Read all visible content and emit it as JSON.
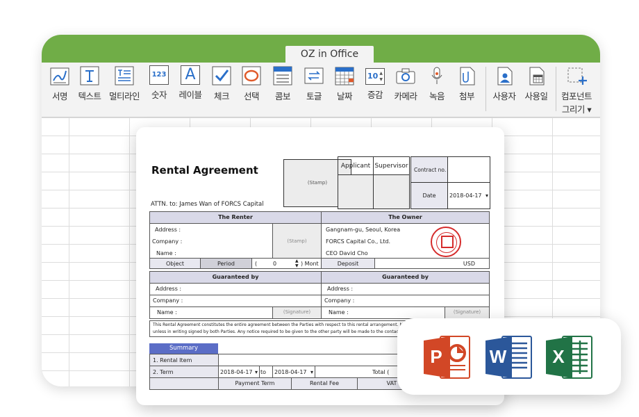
{
  "tab": "OZ in Office",
  "ribbon": [
    {
      "label": "서명",
      "icon": "signature-icon"
    },
    {
      "label": "텍스트",
      "icon": "text-icon"
    },
    {
      "label": "멀티라인",
      "icon": "multiline-icon"
    },
    {
      "label": "숫자",
      "icon": "number-icon"
    },
    {
      "label": "레이블",
      "icon": "label-icon"
    },
    {
      "label": "체크",
      "icon": "check-icon"
    },
    {
      "label": "선택",
      "icon": "select-icon"
    },
    {
      "label": "콤보",
      "icon": "combo-icon"
    },
    {
      "label": "토글",
      "icon": "toggle-icon"
    },
    {
      "label": "날짜",
      "icon": "date-icon"
    },
    {
      "label": "증감",
      "icon": "stepper-icon"
    },
    {
      "label": "카메라",
      "icon": "camera-icon"
    },
    {
      "label": "녹음",
      "icon": "microphone-icon"
    },
    {
      "label": "첨부",
      "icon": "attach-icon"
    },
    {
      "label": "사용자",
      "icon": "user-icon"
    },
    {
      "label": "사용일",
      "icon": "use-date-icon"
    },
    {
      "label": "컴포넌트",
      "label2": "그리기",
      "icon": "draw-component-icon"
    }
  ],
  "ribbon_glyphs": {
    "number": "123",
    "label": "A",
    "stepper": "10"
  },
  "doc": {
    "title": "Rental Agreement",
    "stamp": "(Stamp)",
    "attn": "ATTN. to: James Wan of FORCS Capital",
    "applicant": "Applicant",
    "supervisor": "Supervisor",
    "contract_no": "Contract no.",
    "date_label": "Date",
    "date_value": "2018-04-17",
    "renter": "The Renter",
    "owner": "The Owner",
    "address": "Address :",
    "company": "Company :",
    "name": "Name :",
    "renter_stamp": "(Stamp)",
    "owner_address": "Gangnam-gu, Seoul, Korea",
    "owner_company": "FORCS Capital Co., Ltd.",
    "owner_name": "CEO  David Cho",
    "object": "Object",
    "period": "Period",
    "period_open": "(",
    "period_value": "0",
    "period_unit": ") Mont",
    "deposit": "Deposit",
    "usd": "USD",
    "guaranteed": "Guaranteed by",
    "signature": "(Signature)",
    "legal1": "This Rental Agreement constitutes the entire agreement between the Parties with respect to this rental arrangement.  No m",
    "legal2": "unless in writing signed by both Parties.  Any notice required to be given to the other party will be made to the contact inf",
    "summary": "Summary",
    "rental_item": "1. Rental Item",
    "term": "2. Term",
    "term_from": "2018-04-17",
    "term_to_label": "to",
    "term_to": "2018-04-17",
    "total": "Total (",
    "payment_term": "Payment Term",
    "rental_fee": "Rental Fee",
    "vat": "VAT"
  },
  "apps": [
    {
      "name": "PowerPoint",
      "letter": "P",
      "color": "#d24726"
    },
    {
      "name": "Word",
      "letter": "W",
      "color": "#2b579a"
    },
    {
      "name": "Excel",
      "letter": "X",
      "color": "#217346"
    }
  ]
}
